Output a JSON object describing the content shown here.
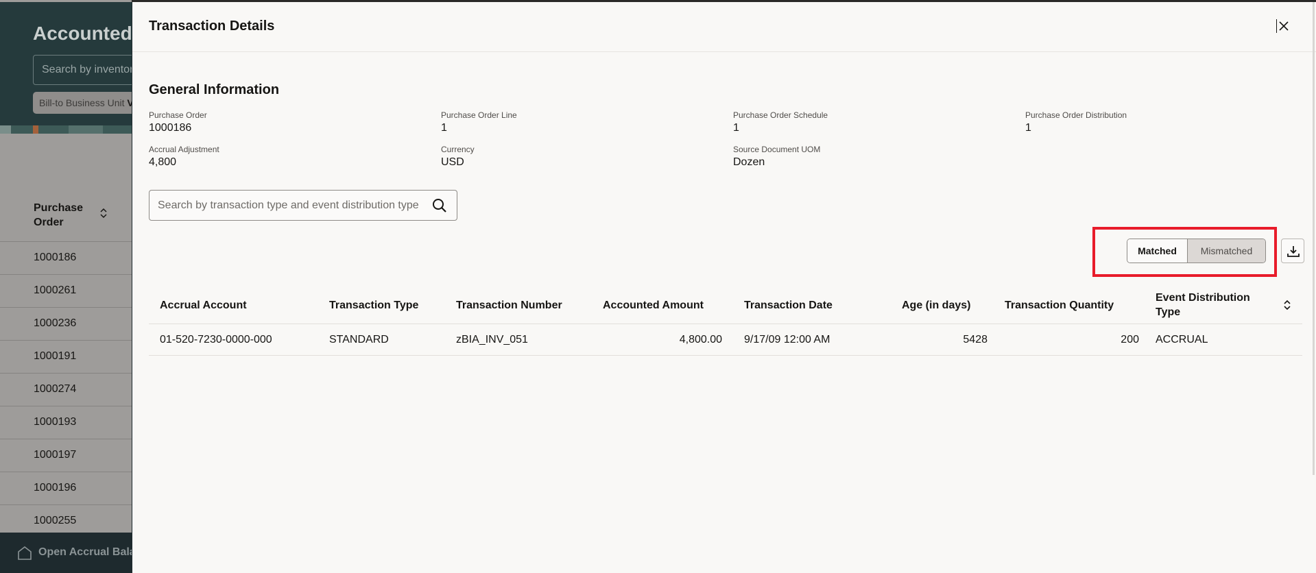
{
  "background": {
    "page_title": "Accounted",
    "search_placeholder": "Search by inventory",
    "filter_chip_label": "Bill-to Business Unit",
    "filter_chip_value": "V",
    "table_header": "Purchase Order",
    "rows": [
      "1000186",
      "1000261",
      "1000236",
      "1000191",
      "1000274",
      "1000193",
      "1000197",
      "1000196",
      "1000255"
    ],
    "footer_label": "Open Accrual Bala"
  },
  "drawer": {
    "title": "Transaction Details",
    "close_label": "Close",
    "section_title": "General Information",
    "fields": [
      {
        "label": "Purchase Order",
        "value": "1000186"
      },
      {
        "label": "Purchase Order Line",
        "value": "1"
      },
      {
        "label": "Purchase Order Schedule",
        "value": "1"
      },
      {
        "label": "Purchase Order Distribution",
        "value": "1"
      },
      {
        "label": "Accrual Adjustment",
        "value": "4,800"
      },
      {
        "label": "Currency",
        "value": "USD"
      },
      {
        "label": "Source Document UOM",
        "value": "Dozen"
      }
    ],
    "search_placeholder": "Search by transaction type and event distribution type",
    "filter": {
      "options": [
        "Matched",
        "Mismatched"
      ],
      "selected": "Mismatched"
    },
    "highlight_color": "#e81c2a",
    "table": {
      "columns": [
        "Accrual Account",
        "Transaction Type",
        "Transaction Number",
        "Accounted Amount",
        "Transaction Date",
        "Age (in days)",
        "Transaction Quantity",
        "Event Distribution Type"
      ],
      "rows": [
        [
          "01-520-7230-0000-000",
          "STANDARD",
          "zBIA_INV_051",
          "4,800.00",
          "9/17/09 12:00 AM",
          "5428",
          "200",
          "ACCRUAL"
        ]
      ]
    }
  }
}
